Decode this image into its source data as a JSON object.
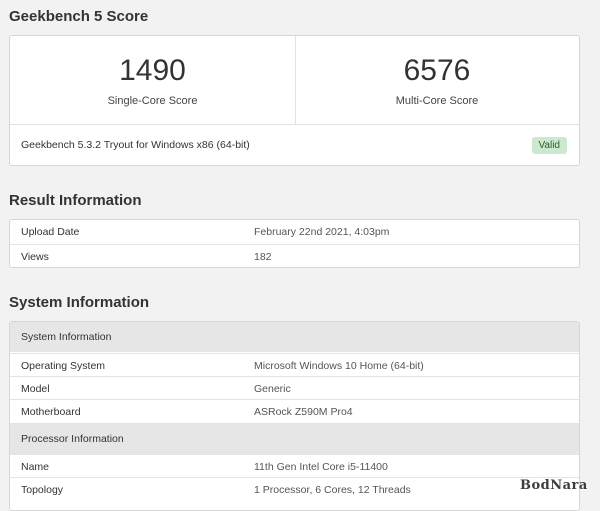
{
  "score": {
    "title": "Geekbench 5 Score",
    "single_core": {
      "value": "1490",
      "label": "Single-Core Score"
    },
    "multi_core": {
      "value": "6576",
      "label": "Multi-Core Score"
    },
    "version": "Geekbench 5.3.2 Tryout for Windows x86 (64-bit)",
    "badge": "Valid"
  },
  "result": {
    "title": "Result Information",
    "rows": [
      {
        "key": "Upload Date",
        "value": "February 22nd 2021, 4:03pm"
      },
      {
        "key": "Views",
        "value": "182"
      }
    ]
  },
  "system": {
    "title": "System Information",
    "header1": "System Information",
    "rows1": [
      {
        "key": "Operating System",
        "value": "Microsoft Windows 10 Home (64-bit)"
      },
      {
        "key": "Model",
        "value": "Generic"
      },
      {
        "key": "Motherboard",
        "value": "ASRock Z590M Pro4"
      }
    ],
    "header2": "Processor Information",
    "rows2": [
      {
        "key": "Name",
        "value": "11th Gen Intel Core i5-11400"
      },
      {
        "key": "Topology",
        "value": "1 Processor, 6 Cores, 12 Threads"
      }
    ]
  },
  "watermark": "BodNara",
  "colors": {
    "valid_badge_bg": "#cce8cf",
    "header_row_bg": "#e6e6e6",
    "page_bg": "#f2f2f2"
  }
}
